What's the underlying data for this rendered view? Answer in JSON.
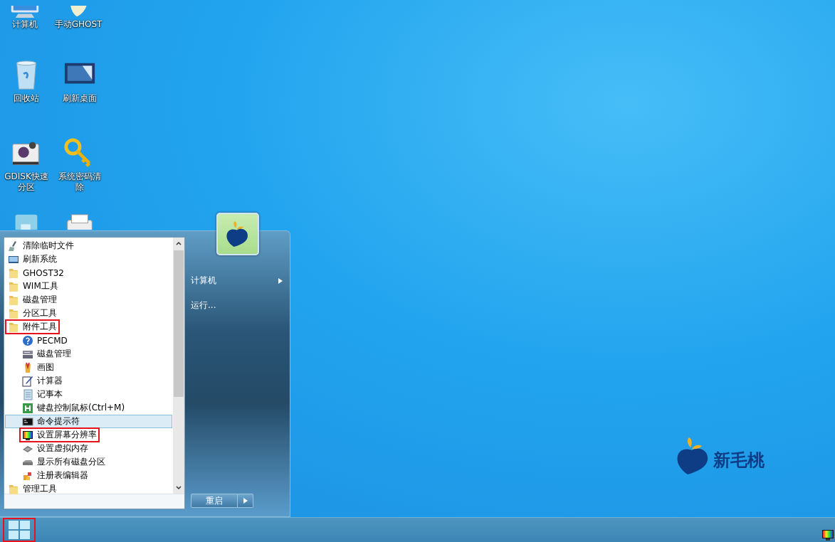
{
  "desktop_icons": [
    {
      "label": "计算机",
      "kind": "computer"
    },
    {
      "label": "手动GHOST",
      "kind": "ghost"
    },
    {
      "label": "回收站",
      "kind": "recycle"
    },
    {
      "label": "刷新桌面",
      "kind": "wallpaper"
    },
    {
      "label": "GDISK快速分区",
      "kind": "gdisk"
    },
    {
      "label": "系统密码清除",
      "kind": "key"
    },
    {
      "kind": "window"
    },
    {
      "kind": "printer"
    }
  ],
  "start_menu": {
    "programs": [
      {
        "label": "清除临时文件",
        "kind": "cleaner",
        "selected": false,
        "highlighted": false
      },
      {
        "label": "刷新系统",
        "kind": "display",
        "selected": false,
        "highlighted": false
      },
      {
        "label": "GHOST32",
        "kind": "folder",
        "selected": false,
        "highlighted": false
      },
      {
        "label": "WIM工具",
        "kind": "folder",
        "selected": false,
        "highlighted": false
      },
      {
        "label": "磁盘管理",
        "kind": "folder",
        "selected": false,
        "highlighted": false
      },
      {
        "label": "分区工具",
        "kind": "folder",
        "selected": false,
        "highlighted": false
      },
      {
        "label": "附件工具",
        "kind": "folder",
        "selected": false,
        "highlighted": true,
        "children": [
          {
            "label": "PECMD",
            "kind": "help",
            "selected": false,
            "highlighted": false
          },
          {
            "label": "磁盘管理",
            "kind": "disk",
            "selected": false,
            "highlighted": false
          },
          {
            "label": "画图",
            "kind": "paint",
            "selected": false,
            "highlighted": false
          },
          {
            "label": "计算器",
            "kind": "pen",
            "selected": false,
            "highlighted": false
          },
          {
            "label": "记事本",
            "kind": "notepad",
            "selected": false,
            "highlighted": false
          },
          {
            "label": "键盘控制鼠标(Ctrl+M)",
            "kind": "hkey",
            "selected": false,
            "highlighted": false
          },
          {
            "label": "命令提示符",
            "kind": "console",
            "selected": true,
            "highlighted": false
          },
          {
            "label": "设置屏幕分辨率",
            "kind": "screen",
            "selected": false,
            "highlighted": true
          },
          {
            "label": "设置虚拟内存",
            "kind": "chip",
            "selected": false,
            "highlighted": false
          },
          {
            "label": "显示所有磁盘分区",
            "kind": "drive",
            "selected": false,
            "highlighted": false
          },
          {
            "label": "注册表编辑器",
            "kind": "registry",
            "selected": false,
            "highlighted": false
          }
        ]
      },
      {
        "label": "管理工具",
        "kind": "folder",
        "selected": false,
        "highlighted": false
      }
    ],
    "places": [
      {
        "label": "计算机",
        "has_submenu": true
      },
      {
        "label": "运行...",
        "has_submenu": false
      }
    ],
    "power_button": {
      "label": "重启"
    }
  },
  "logo": {
    "text": "新毛桃"
  },
  "taskbar": {
    "start_highlighted": true
  }
}
